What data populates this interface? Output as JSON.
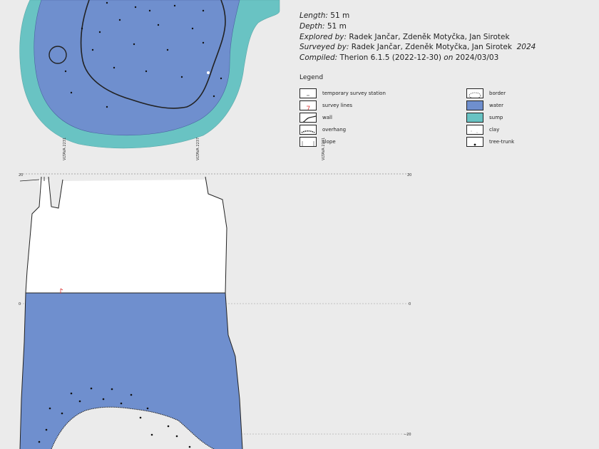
{
  "info": {
    "length_label": "Length:",
    "length_value": "51 m",
    "depth_label": "Depth:",
    "depth_value": "51 m",
    "explored_label": "Explored by:",
    "explored_value": "Radek Jančar,  Zdeněk Motyčka,  Jan Sirotek",
    "surveyed_label": "Surveyed by:",
    "surveyed_value": "Radek Jančar,  Zdeněk Motyčka,  Jan Sirotek",
    "surveyed_year": "2024",
    "compiled_label": "Compiled:",
    "compiled_value": "Therion 6.1.5 (2022-12-30)",
    "compiled_on": "on",
    "compiled_date": "2024/03/03"
  },
  "legend": {
    "title": "Legend",
    "items": [
      {
        "label": "temporary survey station",
        "symbol": "station"
      },
      {
        "label": "survey lines",
        "symbol": "survey-line"
      },
      {
        "label": "wall",
        "symbol": "wall"
      },
      {
        "label": "overhang",
        "symbol": "overhang"
      },
      {
        "label": "slope",
        "symbol": "slope"
      },
      {
        "label": "border",
        "symbol": "border"
      },
      {
        "label": "water",
        "symbol": "water"
      },
      {
        "label": "sump",
        "symbol": "sump"
      },
      {
        "label": "clay",
        "symbol": "clay"
      },
      {
        "label": "tree-trunk",
        "symbol": "tree-trunk"
      }
    ]
  },
  "plan_labels": {
    "left_station": "VLTAVA 2231",
    "right_station": "VLTAVA 2237",
    "far_station": "VLTAVA 2231",
    "point_a": "•••"
  },
  "profile_labels": {
    "left_top": "20",
    "right_top": "20",
    "left_mid": "0",
    "right_mid": "0",
    "right_bottom": "−20"
  },
  "colors": {
    "background": "#ebebeb",
    "water": "#6f8fce",
    "sump": "#69c3c3",
    "clay": "#ffffff",
    "wall": "#222222"
  }
}
